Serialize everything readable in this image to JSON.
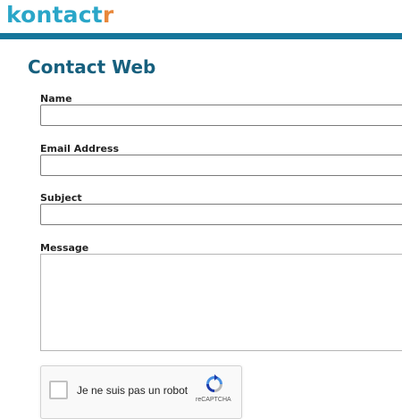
{
  "header": {
    "logo_main": "kontact",
    "logo_accent": "r"
  },
  "page": {
    "title": "Contact Web"
  },
  "form": {
    "name_label": "Name",
    "name_value": "",
    "email_label": "Email Address",
    "email_value": "",
    "subject_label": "Subject",
    "subject_value": "",
    "message_label": "Message",
    "message_value": ""
  },
  "captcha": {
    "label": "Je ne suis pas un robot",
    "brand": "reCAPTCHA"
  },
  "colors": {
    "brand_bar": "#16769b",
    "title": "#17607e",
    "logo": "#2aa6c8",
    "logo_accent": "#e8873a"
  },
  "icons": {
    "captcha": "recaptcha-icon",
    "checkbox": "checkbox-icon"
  }
}
